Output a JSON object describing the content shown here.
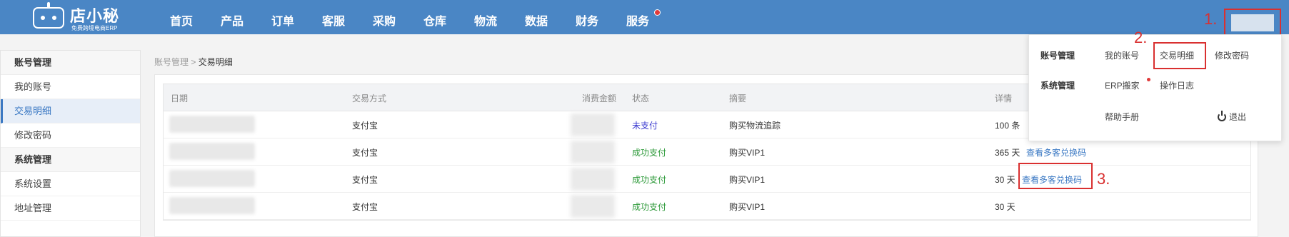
{
  "logo": {
    "name": "店小秘",
    "tagline": "免费跨境电商ERP"
  },
  "nav": [
    "首页",
    "产品",
    "订单",
    "客服",
    "采购",
    "仓库",
    "物流",
    "数据",
    "财务",
    "服务"
  ],
  "sidebar": {
    "groups": [
      {
        "title": "账号管理",
        "items": [
          "我的账号",
          "交易明细",
          "修改密码"
        ]
      },
      {
        "title": "系统管理",
        "items": [
          "系统设置",
          "地址管理"
        ]
      }
    ],
    "active": "交易明细"
  },
  "breadcrumb": {
    "parent": "账号管理",
    "sep": ">",
    "current": "交易明细"
  },
  "table": {
    "headers": [
      "日期",
      "交易方式",
      "消费金额",
      "状态",
      "摘要",
      "详情"
    ],
    "rows": [
      {
        "method": "支付宝",
        "status": "未支付",
        "summary": "购买物流追踪",
        "detail": "100 条",
        "link": ""
      },
      {
        "method": "支付宝",
        "status": "成功支付",
        "summary": "购买VIP1",
        "detail": "365 天",
        "link": "查看多客兑换码"
      },
      {
        "method": "支付宝",
        "status": "成功支付",
        "summary": "购买VIP1",
        "detail": "30 天",
        "link": "查看多客兑换码"
      },
      {
        "method": "支付宝",
        "status": "成功支付",
        "summary": "购买VIP1",
        "detail": "30 天",
        "link": ""
      }
    ]
  },
  "dropdown": {
    "account_head": "账号管理",
    "my_account": "我的账号",
    "transactions": "交易明细",
    "change_password": "修改密码",
    "system_head": "系统管理",
    "erp_move": "ERP搬家",
    "operation_log": "操作日志",
    "help": "帮助手册",
    "logout": "退出"
  },
  "annotations": [
    "1.",
    "2.",
    "3."
  ],
  "colors": {
    "nav_bg": "#4a86c5",
    "annotation": "#d93030",
    "paid": "#2e9a3a",
    "unpaid": "#3b3bd0",
    "link": "#3a78c3"
  }
}
